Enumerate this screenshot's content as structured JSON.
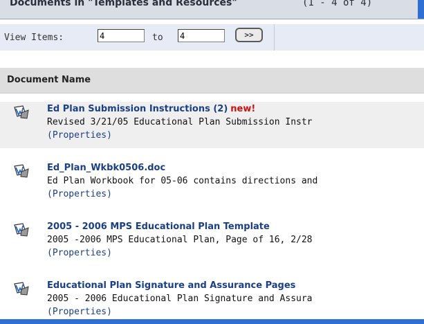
{
  "section": {
    "title": "Documents in \"Templates and Resources\"",
    "count": "(1 - 4 of 4)"
  },
  "view": {
    "label": "View Items:",
    "from_value": "4",
    "to_label": "to",
    "to_value": "4",
    "go_label": ">>"
  },
  "table": {
    "column_header": "Document Name",
    "rows": [
      {
        "name": "Ed Plan Submission Instructions (2)",
        "badge": "new!",
        "description": "Revised 3/21/05 Educational Plan Submission Instr",
        "properties": "(Properties)"
      },
      {
        "name": "Ed_Plan_Wkbk0506.doc",
        "badge": "",
        "description": "Ed Plan Workbook for 05-06 contains directions and",
        "properties": "(Properties)"
      },
      {
        "name": "2005 - 2006 MPS Educational Plan Template",
        "badge": "",
        "description": "2005 -2006 MPS Educational Plan, Page of 16, 2/28",
        "properties": "(Properties)"
      },
      {
        "name": "Educational Plan Signature and Assurance Pages",
        "badge": "",
        "description": "2005 - 2006 Educational Plan Signature and Assura",
        "properties": "(Properties)"
      }
    ]
  },
  "icons": {
    "document": "word-document-icon"
  },
  "colors": {
    "link": "#1b3f84",
    "new_badge": "#cc1111",
    "accent_blue": "#2f6fd4"
  }
}
